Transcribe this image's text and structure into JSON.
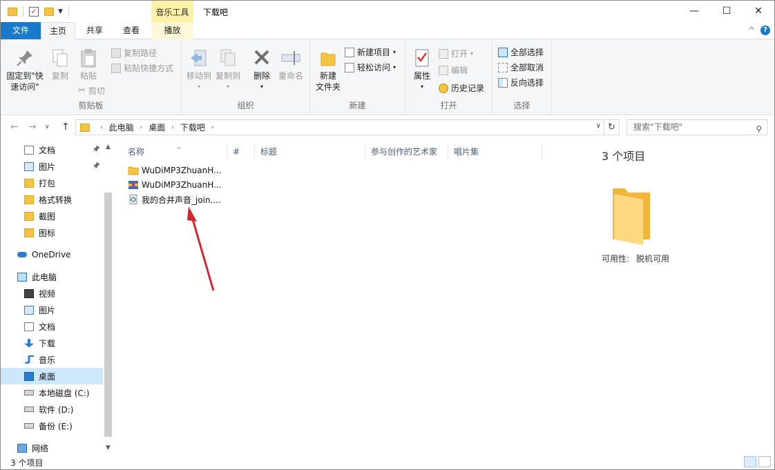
{
  "titlebar": {
    "context_tab": "音乐工具",
    "window_title": "下载吧",
    "minimize_glyph": "—",
    "maximize_glyph": "☐",
    "close_glyph": "✕"
  },
  "tabs": {
    "file": "文件",
    "home": "主页",
    "share": "共享",
    "view": "查看",
    "play": "播放",
    "collapse_glyph": "^",
    "help_glyph": "?"
  },
  "ribbon": {
    "clipboard": {
      "label": "剪贴板",
      "pin_line1": "固定到\"快",
      "pin_line2": "速访问\"",
      "copy": "复制",
      "paste": "粘贴",
      "copy_path": "复制路径",
      "paste_shortcut": "粘贴快捷方式",
      "cut": "剪切"
    },
    "organize": {
      "label": "组织",
      "move_to": "移动到",
      "copy_to": "复制到",
      "delete": "删除",
      "rename": "重命名"
    },
    "new": {
      "label": "新建",
      "new_folder_line1": "新建",
      "new_folder_line2": "文件夹",
      "new_item": "新建项目",
      "easy_access": "轻松访问"
    },
    "open": {
      "label": "打开",
      "properties": "属性",
      "open": "打开",
      "edit": "编辑",
      "history": "历史记录"
    },
    "select": {
      "label": "选择",
      "select_all": "全部选择",
      "select_none": "全部取消",
      "invert": "反向选择"
    }
  },
  "address": {
    "crumbs": [
      "此电脑",
      "桌面",
      "下载吧"
    ],
    "search_placeholder": "搜索\"下载吧\""
  },
  "navpane": {
    "items": [
      {
        "label": "文档",
        "icon": "documents-icon",
        "pinned": true
      },
      {
        "label": "图片",
        "icon": "pictures-icon",
        "pinned": true
      },
      {
        "label": "打包",
        "icon": "folder-icon"
      },
      {
        "label": "格式转换",
        "icon": "folder-icon"
      },
      {
        "label": "截图",
        "icon": "folder-icon"
      },
      {
        "label": "图标",
        "icon": "folder-icon"
      },
      {
        "label": "OneDrive",
        "icon": "onedrive-icon"
      },
      {
        "label": "此电脑",
        "icon": "this-pc-icon"
      },
      {
        "label": "视频",
        "icon": "videos-icon"
      },
      {
        "label": "图片",
        "icon": "pictures-icon"
      },
      {
        "label": "文档",
        "icon": "documents-icon"
      },
      {
        "label": "下载",
        "icon": "downloads-icon"
      },
      {
        "label": "音乐",
        "icon": "music-icon"
      },
      {
        "label": "桌面",
        "icon": "desktop-icon",
        "selected": true
      },
      {
        "label": "本地磁盘 (C:)",
        "icon": "drive-icon"
      },
      {
        "label": "软件 (D:)",
        "icon": "drive-icon"
      },
      {
        "label": "备份 (E:)",
        "icon": "drive-icon"
      },
      {
        "label": "网络",
        "icon": "network-icon"
      }
    ]
  },
  "filelist": {
    "columns": [
      "名称",
      "#",
      "标题",
      "参与创作的艺术家",
      "唱片集"
    ],
    "rows": [
      {
        "name": "WuDiMP3ZhuanH...",
        "icon": "folder-icon"
      },
      {
        "name": "WuDiMP3ZhuanH...",
        "icon": "archive-icon"
      },
      {
        "name": "我的合并声音_join....",
        "icon": "audio-file-icon"
      }
    ]
  },
  "details": {
    "count": "3 个项目",
    "availability_label": "可用性:",
    "availability_value": "脱机可用"
  },
  "status": {
    "count": "3 个项目"
  },
  "colors": {
    "accent": "#1979ca",
    "selection": "#cce8ff",
    "context_tab": "#fdf1a6",
    "annotation_arrow": "#d0282e"
  }
}
